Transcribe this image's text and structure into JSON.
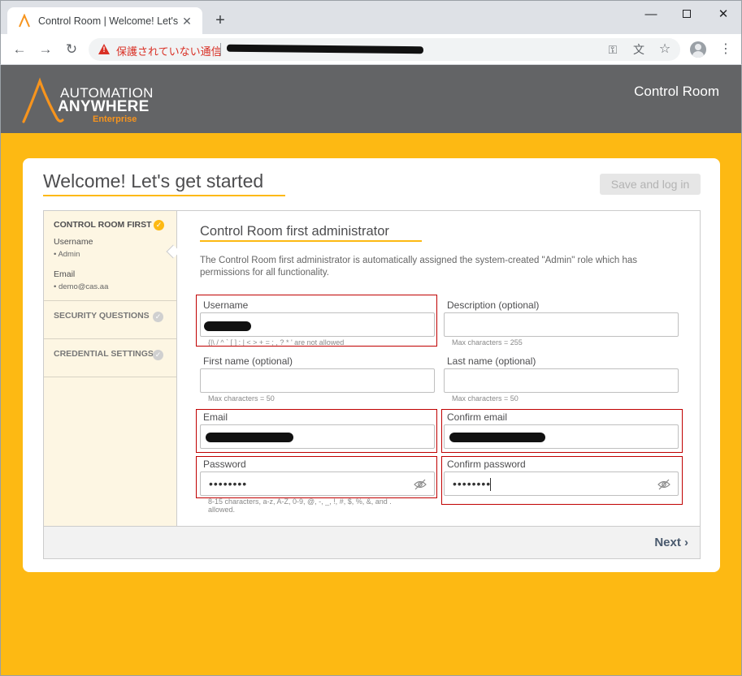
{
  "browser": {
    "tab_title": "Control Room | Welcome! Let's get started",
    "not_secure_label": "保護されていない通信",
    "win_min": "—",
    "win_close": "✕",
    "new_tab": "+",
    "back": "←",
    "forward": "→",
    "reload": "↻",
    "key_icon": "⚿",
    "translate_icon": "文",
    "star_icon": "☆",
    "menu_icon": "⋮",
    "tab_close": "✕"
  },
  "header": {
    "logo_line1": "AUTOMATION",
    "logo_line2": "ANYWHERE",
    "logo_line3": "Enterprise",
    "title": "Control Room"
  },
  "page": {
    "title": "Welcome! Let's get started",
    "save_button": "Save and log in"
  },
  "steps": [
    {
      "label": "CONTROL ROOM FIRST ...",
      "status": "completed",
      "fields": [
        {
          "label": "Username",
          "value": "• Admin"
        },
        {
          "label": "Email",
          "value": "• demo@cas.aa"
        }
      ]
    },
    {
      "label": "SECURITY QUESTIONS",
      "status": "pending"
    },
    {
      "label": "CREDENTIAL SETTINGS",
      "status": "pending"
    }
  ],
  "form": {
    "section_title": "Control Room first administrator",
    "description": "The Control Room first administrator is automatically assigned the system-created \"Admin\" role which has permissions for all functionality.",
    "username": {
      "label": "Username",
      "hint": "{|\\ / ^ ` [ ] : | < > + = ; , ? * ' are not allowed"
    },
    "description_field": {
      "label": "Description (optional)",
      "hint": "Max characters = 255"
    },
    "first_name": {
      "label": "First name (optional)",
      "hint": "Max characters = 50"
    },
    "last_name": {
      "label": "Last name (optional)",
      "hint": "Max characters = 50"
    },
    "email": {
      "label": "Email"
    },
    "confirm_email": {
      "label": "Confirm email"
    },
    "password": {
      "label": "Password",
      "value": "••••••••",
      "hint": "8-15 characters, a-z, A-Z, 0-9, @, -, _, !, #, $, %, &, and . allowed."
    },
    "confirm_password": {
      "label": "Confirm password",
      "value": "••••••••"
    }
  },
  "footer": {
    "next_button": "Next ›"
  },
  "colors": {
    "accent": "#fdb913",
    "header_bg": "#636466",
    "annotation_red": "#c00000"
  }
}
